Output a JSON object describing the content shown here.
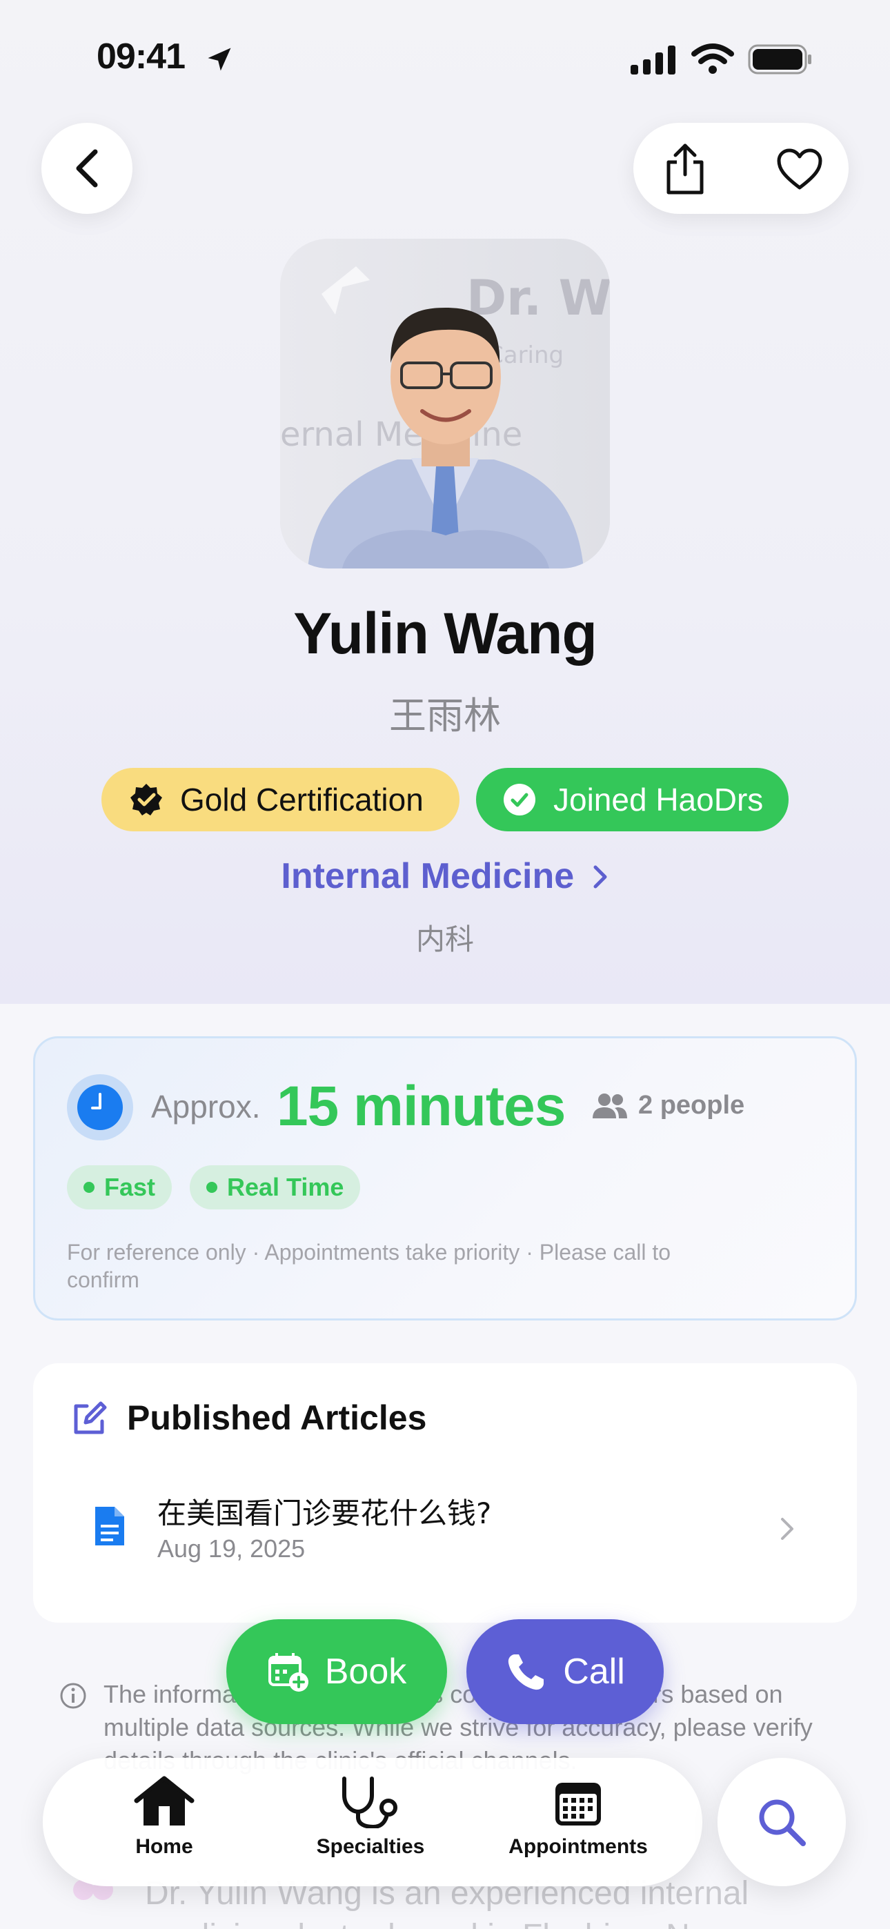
{
  "status": {
    "time": "09:41"
  },
  "doctor": {
    "name": "Yulin Wang",
    "name_cn": "王雨林",
    "badge_gold": "Gold Certification",
    "badge_joined": "Joined HaoDrs",
    "specialty": "Internal Medicine",
    "specialty_cn": "内科"
  },
  "wait": {
    "approx_label": "Approx.",
    "minutes": "15 minutes",
    "people": "2 people",
    "tags": [
      "Fast",
      "Real Time"
    ],
    "disclaimer": "For reference only · Appointments take priority · Please call to confirm"
  },
  "articles": {
    "title": "Published Articles",
    "items": [
      {
        "title": "在美国看门诊要花什么钱?",
        "date": "Aug 19, 2025"
      }
    ]
  },
  "info": {
    "text": "The information on this page is compiled by HaoDrs based on multiple data sources. While we strive for accuracy, please verify details through the clinic's official channels.",
    "about": "Dr. Yulin Wang is an experienced internal medicine doctor based in Flushing, New"
  },
  "actions": {
    "book": "Book",
    "call": "Call"
  },
  "tabs": [
    {
      "label": "Home"
    },
    {
      "label": "Specialties"
    },
    {
      "label": "Appointments"
    }
  ],
  "colors": {
    "green": "#34c759",
    "purple": "#5d5fd5",
    "gold": "#f9dc7f"
  },
  "icons": [
    "location-arrow-icon",
    "signal-icon",
    "wifi-icon",
    "battery-icon",
    "back-chevron-icon",
    "share-icon",
    "heart-icon",
    "verified-badge-icon",
    "check-circle-icon",
    "chevron-right-icon",
    "clock-icon",
    "people-icon",
    "edit-icon",
    "document-icon",
    "info-icon",
    "calendar-add-icon",
    "phone-icon",
    "home-icon",
    "stethoscope-icon",
    "calendar-grid-icon",
    "search-icon"
  ]
}
